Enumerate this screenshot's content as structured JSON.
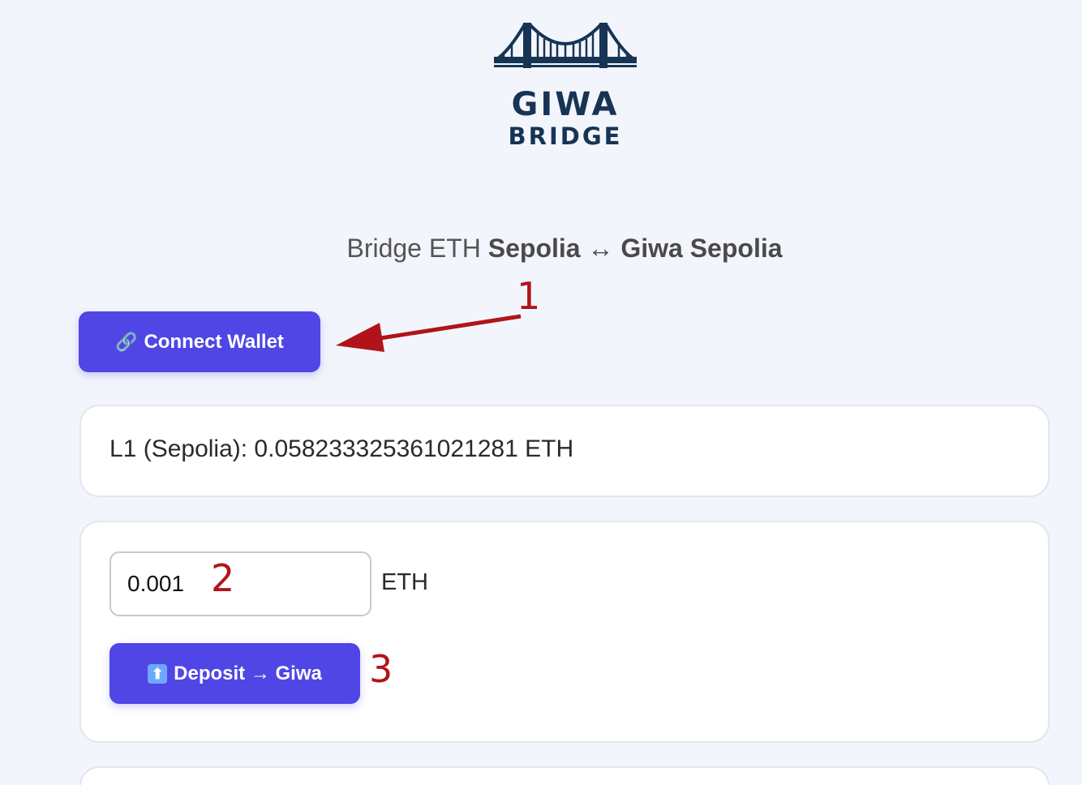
{
  "logo": {
    "line1": "GIWA",
    "line2": "BRIDGE",
    "color": "#173454"
  },
  "subtitle": {
    "prefix": "Bridge ETH",
    "from": "Sepolia",
    "arrow": "↔",
    "to": "Giwa Sepolia"
  },
  "connect": {
    "icon": "🔗",
    "label": "Connect Wallet"
  },
  "balance": {
    "text": "L1 (Sepolia): 0.058233325361021281 ETH"
  },
  "deposit": {
    "amount_value": "0.001",
    "unit": "ETH",
    "button_icon": "⬆",
    "button_label": "Deposit → Giwa"
  },
  "annotations": {
    "step1": "1",
    "step2": "2",
    "step3": "3",
    "color": "#b0141a"
  },
  "colors": {
    "accent": "#4f46e5",
    "background": "#f3f5fc"
  }
}
